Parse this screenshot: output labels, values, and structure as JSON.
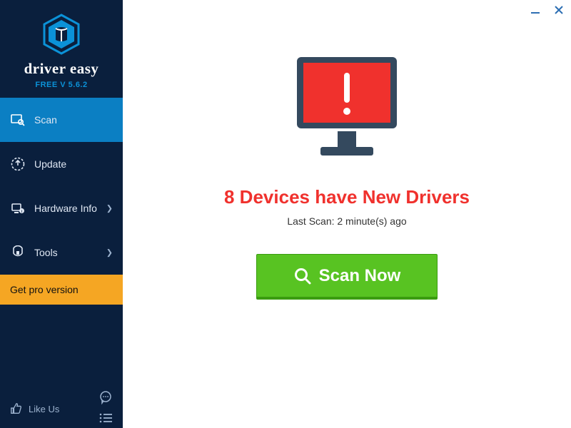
{
  "brand": "driver easy",
  "version": "FREE V 5.6.2",
  "nav": {
    "scan": "Scan",
    "update": "Update",
    "hardware": "Hardware Info",
    "tools": "Tools"
  },
  "get_pro": "Get pro version",
  "like_us": "Like Us",
  "main": {
    "headline": "8 Devices have New Drivers",
    "subtext": "Last Scan: 2 minute(s) ago",
    "scan_button": "Scan Now"
  }
}
